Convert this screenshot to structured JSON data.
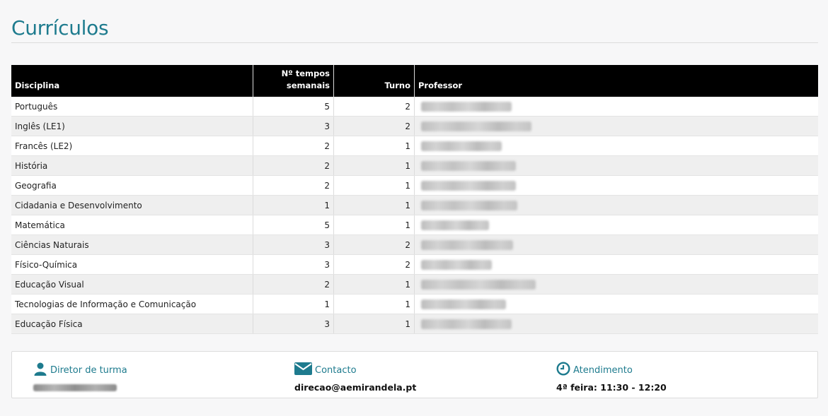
{
  "page": {
    "title": "Currículos"
  },
  "table": {
    "headers": {
      "disciplina": "Disciplina",
      "tempos_line1": "Nº tempos",
      "tempos_line2": "semanais",
      "turno": "Turno",
      "professor": "Professor"
    },
    "rows": [
      {
        "disciplina": "Português",
        "tempos": "5",
        "turno": "2"
      },
      {
        "disciplina": "Inglês (LE1)",
        "tempos": "3",
        "turno": "2"
      },
      {
        "disciplina": "Francês (LE2)",
        "tempos": "2",
        "turno": "1"
      },
      {
        "disciplina": "História",
        "tempos": "2",
        "turno": "1"
      },
      {
        "disciplina": "Geografia",
        "tempos": "2",
        "turno": "1"
      },
      {
        "disciplina": "Cidadania e Desenvolvimento",
        "tempos": "1",
        "turno": "1"
      },
      {
        "disciplina": "Matemática",
        "tempos": "5",
        "turno": "1"
      },
      {
        "disciplina": "Ciências Naturais",
        "tempos": "3",
        "turno": "2"
      },
      {
        "disciplina": "Físico-Química",
        "tempos": "3",
        "turno": "2"
      },
      {
        "disciplina": "Educação Visual",
        "tempos": "2",
        "turno": "1"
      },
      {
        "disciplina": "Tecnologias de Informação e Comunicação",
        "tempos": "1",
        "turno": "1"
      },
      {
        "disciplina": "Educação Física",
        "tempos": "3",
        "turno": "1"
      }
    ]
  },
  "footer": {
    "diretor": {
      "label": "Diretor de turma",
      "icon": "user-icon"
    },
    "contacto": {
      "label": "Contacto",
      "value": "direcao@aemirandela.pt",
      "icon": "envelope-icon"
    },
    "atendimento": {
      "label": "Atendimento",
      "value": "4ª feira: 11:30 - 12:20",
      "icon": "clock-icon"
    }
  },
  "colors": {
    "accent": "#1e7b8e",
    "header_bg": "#000000"
  }
}
